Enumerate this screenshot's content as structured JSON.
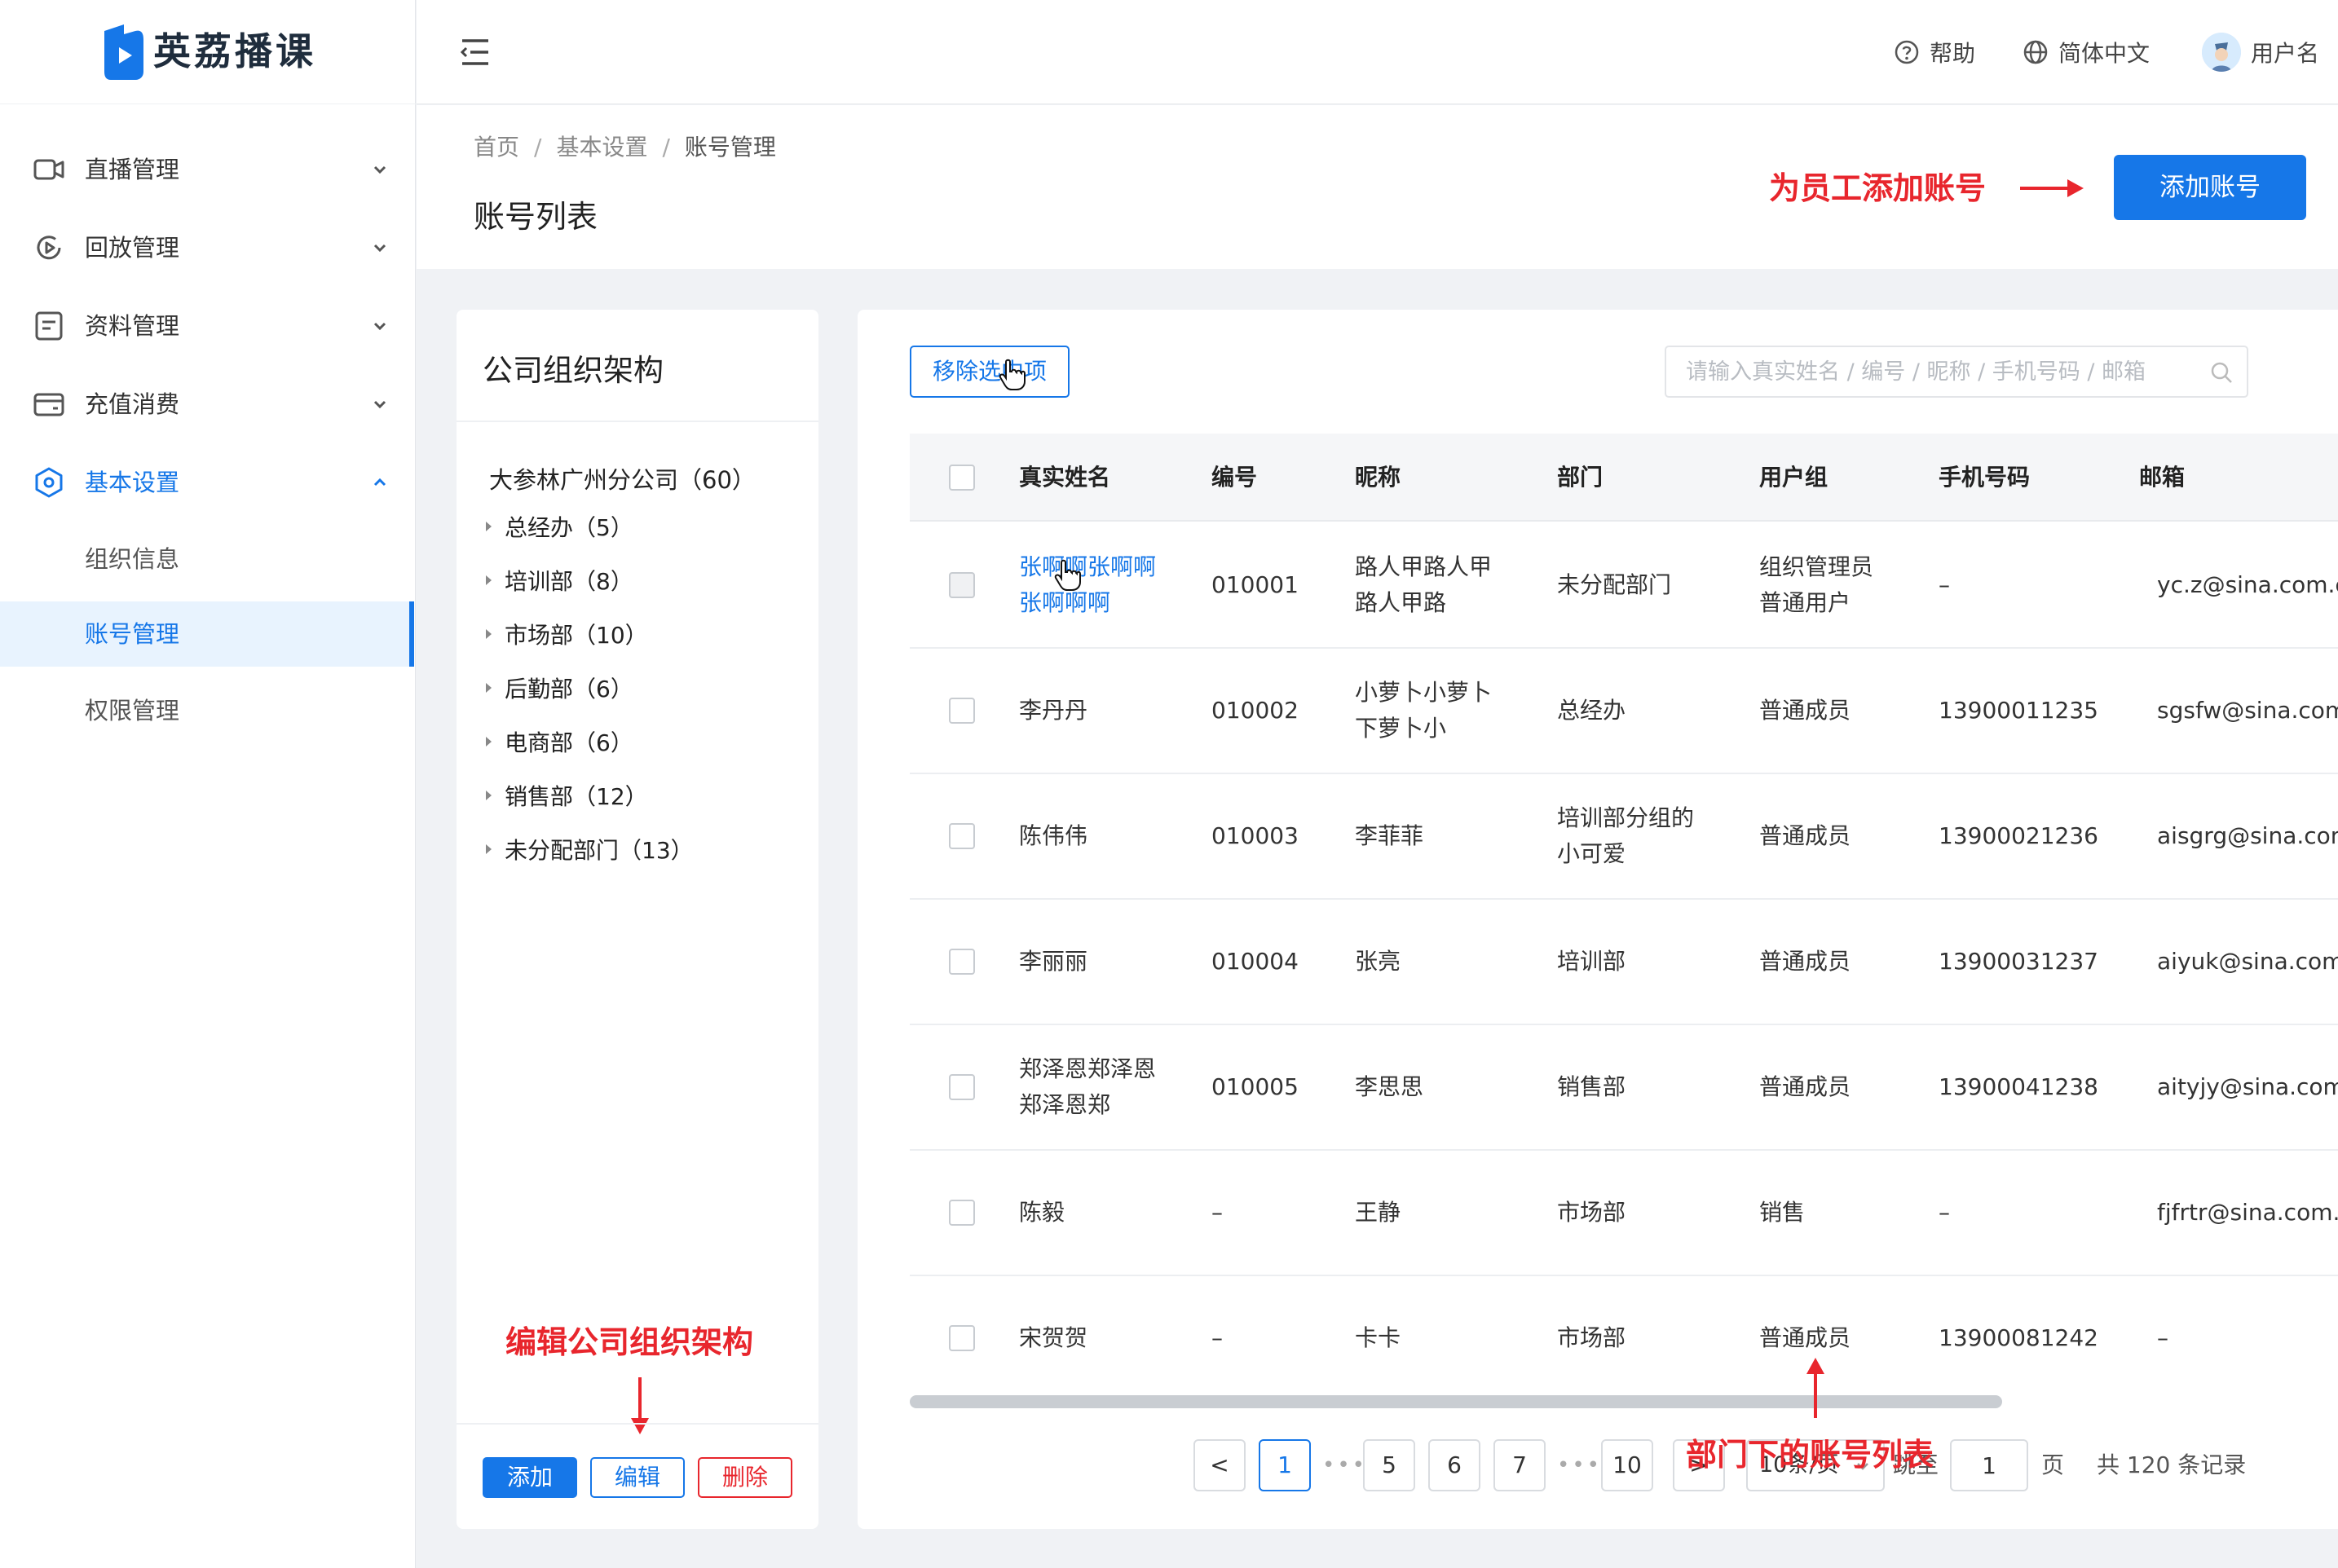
{
  "app": {
    "name": "英荔播课"
  },
  "sidebar": {
    "items": [
      {
        "label": "直播管理",
        "icon": "video-camera-icon",
        "expanded": false
      },
      {
        "label": "回放管理",
        "icon": "replay-icon",
        "expanded": false
      },
      {
        "label": "资料管理",
        "icon": "document-icon",
        "expanded": false
      },
      {
        "label": "充值消费",
        "icon": "wallet-icon",
        "expanded": false
      },
      {
        "label": "基本设置",
        "icon": "settings-icon",
        "expanded": true,
        "children": [
          {
            "label": "组织信息",
            "selected": false
          },
          {
            "label": "账号管理",
            "selected": true
          },
          {
            "label": "权限管理",
            "selected": false
          }
        ]
      }
    ]
  },
  "header": {
    "help": "帮助",
    "language": "简体中文",
    "username": "用户名"
  },
  "breadcrumb": [
    "首页",
    "基本设置",
    "账号管理"
  ],
  "page_title": "账号列表",
  "add_account_button": "添加账号",
  "annotations": {
    "add_account": "为员工添加账号",
    "edit_org": "编辑公司组织架构",
    "dept_list": "部门下的账号列表",
    "color": "#e8262d"
  },
  "org": {
    "title": "公司组织架构",
    "root": "大参林广州分公司（60）",
    "departments": [
      "总经办（5）",
      "培训部（8）",
      "市场部（10）",
      "后勤部（6）",
      "电商部（6）",
      "销售部（12）",
      "未分配部门（13）"
    ],
    "buttons": {
      "add": "添加",
      "edit": "编辑",
      "delete": "删除"
    }
  },
  "toolbar": {
    "remove_selected": "移除选中项",
    "search_placeholder": "请输入真实姓名 / 编号 / 昵称 / 手机号码 / 邮箱"
  },
  "table": {
    "columns": [
      "真实姓名",
      "编号",
      "昵称",
      "部门",
      "用户组",
      "手机号码",
      "邮箱"
    ],
    "rows": [
      {
        "name": "张啊啊张啊啊\n张啊啊啊",
        "id": "010001",
        "nickname": "路人甲路人甲\n路人甲路",
        "dept": "未分配部门",
        "group": "组织管理员\n普通用户",
        "phone": "–",
        "email": "yc.z@sina.com.cn"
      },
      {
        "name": "李丹丹",
        "id": "010002",
        "nickname": "小萝卜小萝卜\n下萝卜小",
        "dept": "总经办",
        "group": "普通成员",
        "phone": "13900011235",
        "email": "sgsfw@sina.com.cn"
      },
      {
        "name": "陈伟伟",
        "id": "010003",
        "nickname": "李菲菲",
        "dept": "培训部分组的\n小可爱",
        "group": "普通成员",
        "phone": "13900021236",
        "email": "aisgrg@sina.com.cn"
      },
      {
        "name": "李丽丽",
        "id": "010004",
        "nickname": "张亮",
        "dept": "培训部",
        "group": "普通成员",
        "phone": "13900031237",
        "email": "aiyuk@sina.com.cn"
      },
      {
        "name": "郑泽恩郑泽恩\n郑泽恩郑",
        "id": "010005",
        "nickname": "李思思",
        "dept": "销售部",
        "group": "普通成员",
        "phone": "13900041238",
        "email": "aityjy@sina.com.cn"
      },
      {
        "name": "陈毅",
        "id": "–",
        "nickname": "王静",
        "dept": "市场部",
        "group": "销售",
        "phone": "–",
        "email": "fjfrtr@sina.com.cn"
      },
      {
        "name": "宋贺贺",
        "id": "–",
        "nickname": "卡卡",
        "dept": "市场部",
        "group": "普通成员",
        "phone": "13900081242",
        "email": "–"
      }
    ]
  },
  "pagination": {
    "prev": "<",
    "pages": [
      "1",
      "5",
      "6",
      "7",
      "10"
    ],
    "current": "1",
    "next": ">",
    "dots": "•••",
    "page_size": "10条/页",
    "goto_label": "跳至",
    "goto_value": "1",
    "page_unit": "页",
    "total": "共 120 条记录"
  },
  "colors": {
    "primary": "#1677e8",
    "danger": "#e8262d",
    "bg": "#f0f2f5"
  }
}
